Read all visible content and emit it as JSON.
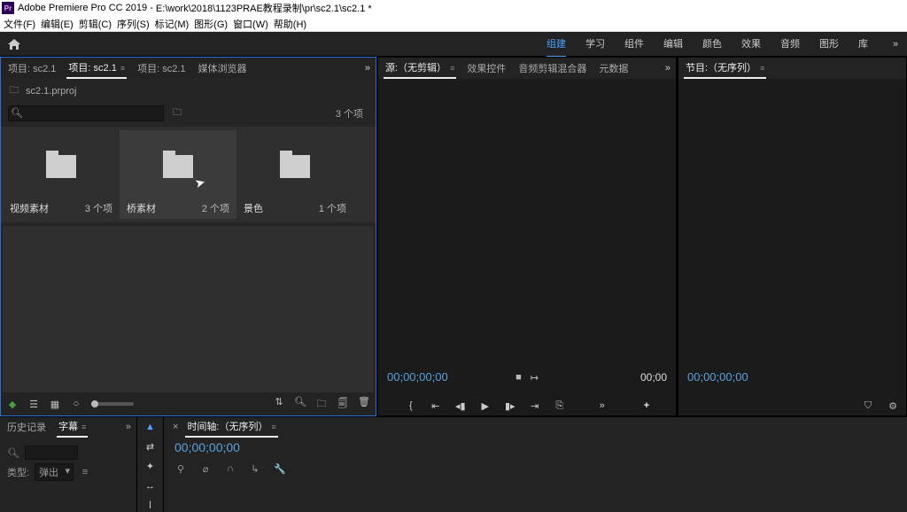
{
  "titlebar": {
    "app": "Adobe Premiere Pro CC 2019",
    "path": "E:\\work\\2018\\1123PRAE教程录制\\pr\\sc2.1\\sc2.1 *"
  },
  "menu": {
    "file": "文件(F)",
    "edit": "编辑(E)",
    "clip": "剪辑(C)",
    "sequence": "序列(S)",
    "mark": "标记(M)",
    "graphics": "图形(G)",
    "window": "窗口(W)",
    "help": "帮助(H)"
  },
  "workspaces": {
    "assembly": "组建",
    "learning": "学习",
    "editing": "组件",
    "edits": "编辑",
    "color": "颜色",
    "effects": "效果",
    "audio": "音频",
    "graphics": "图形",
    "library": "库"
  },
  "projectTabs": {
    "p1": "项目: sc2.1",
    "p2": "项目: sc2.1",
    "p3": "项目: sc2.1",
    "browser": "媒体浏览器"
  },
  "project": {
    "path": "sc2.1.prproj",
    "searchPlaceholder": "",
    "count": "3 个项",
    "bins": [
      {
        "name": "视频素材",
        "count": "3 个项"
      },
      {
        "name": "桥素材",
        "count": "2 个项"
      },
      {
        "name": "景色",
        "count": "1 个项"
      }
    ]
  },
  "sourceTabs": {
    "source": "源:（无剪辑）",
    "effectControls": "效果控件",
    "audioMixer": "音频剪辑混合器",
    "metadata": "元数据"
  },
  "source": {
    "tcLeft": "00;00;00;00",
    "tcRight": "00;00"
  },
  "programTabs": {
    "program": "节目:（无序列）"
  },
  "program": {
    "tc": "00;00;00;00"
  },
  "historyTabs": {
    "history": "历史记录",
    "captions": "字幕"
  },
  "captions": {
    "typeLabel": "类型:",
    "typeValue": "弹出"
  },
  "timeline": {
    "tab": "时间轴:（无序列）",
    "tc": "00;00;00;00"
  }
}
